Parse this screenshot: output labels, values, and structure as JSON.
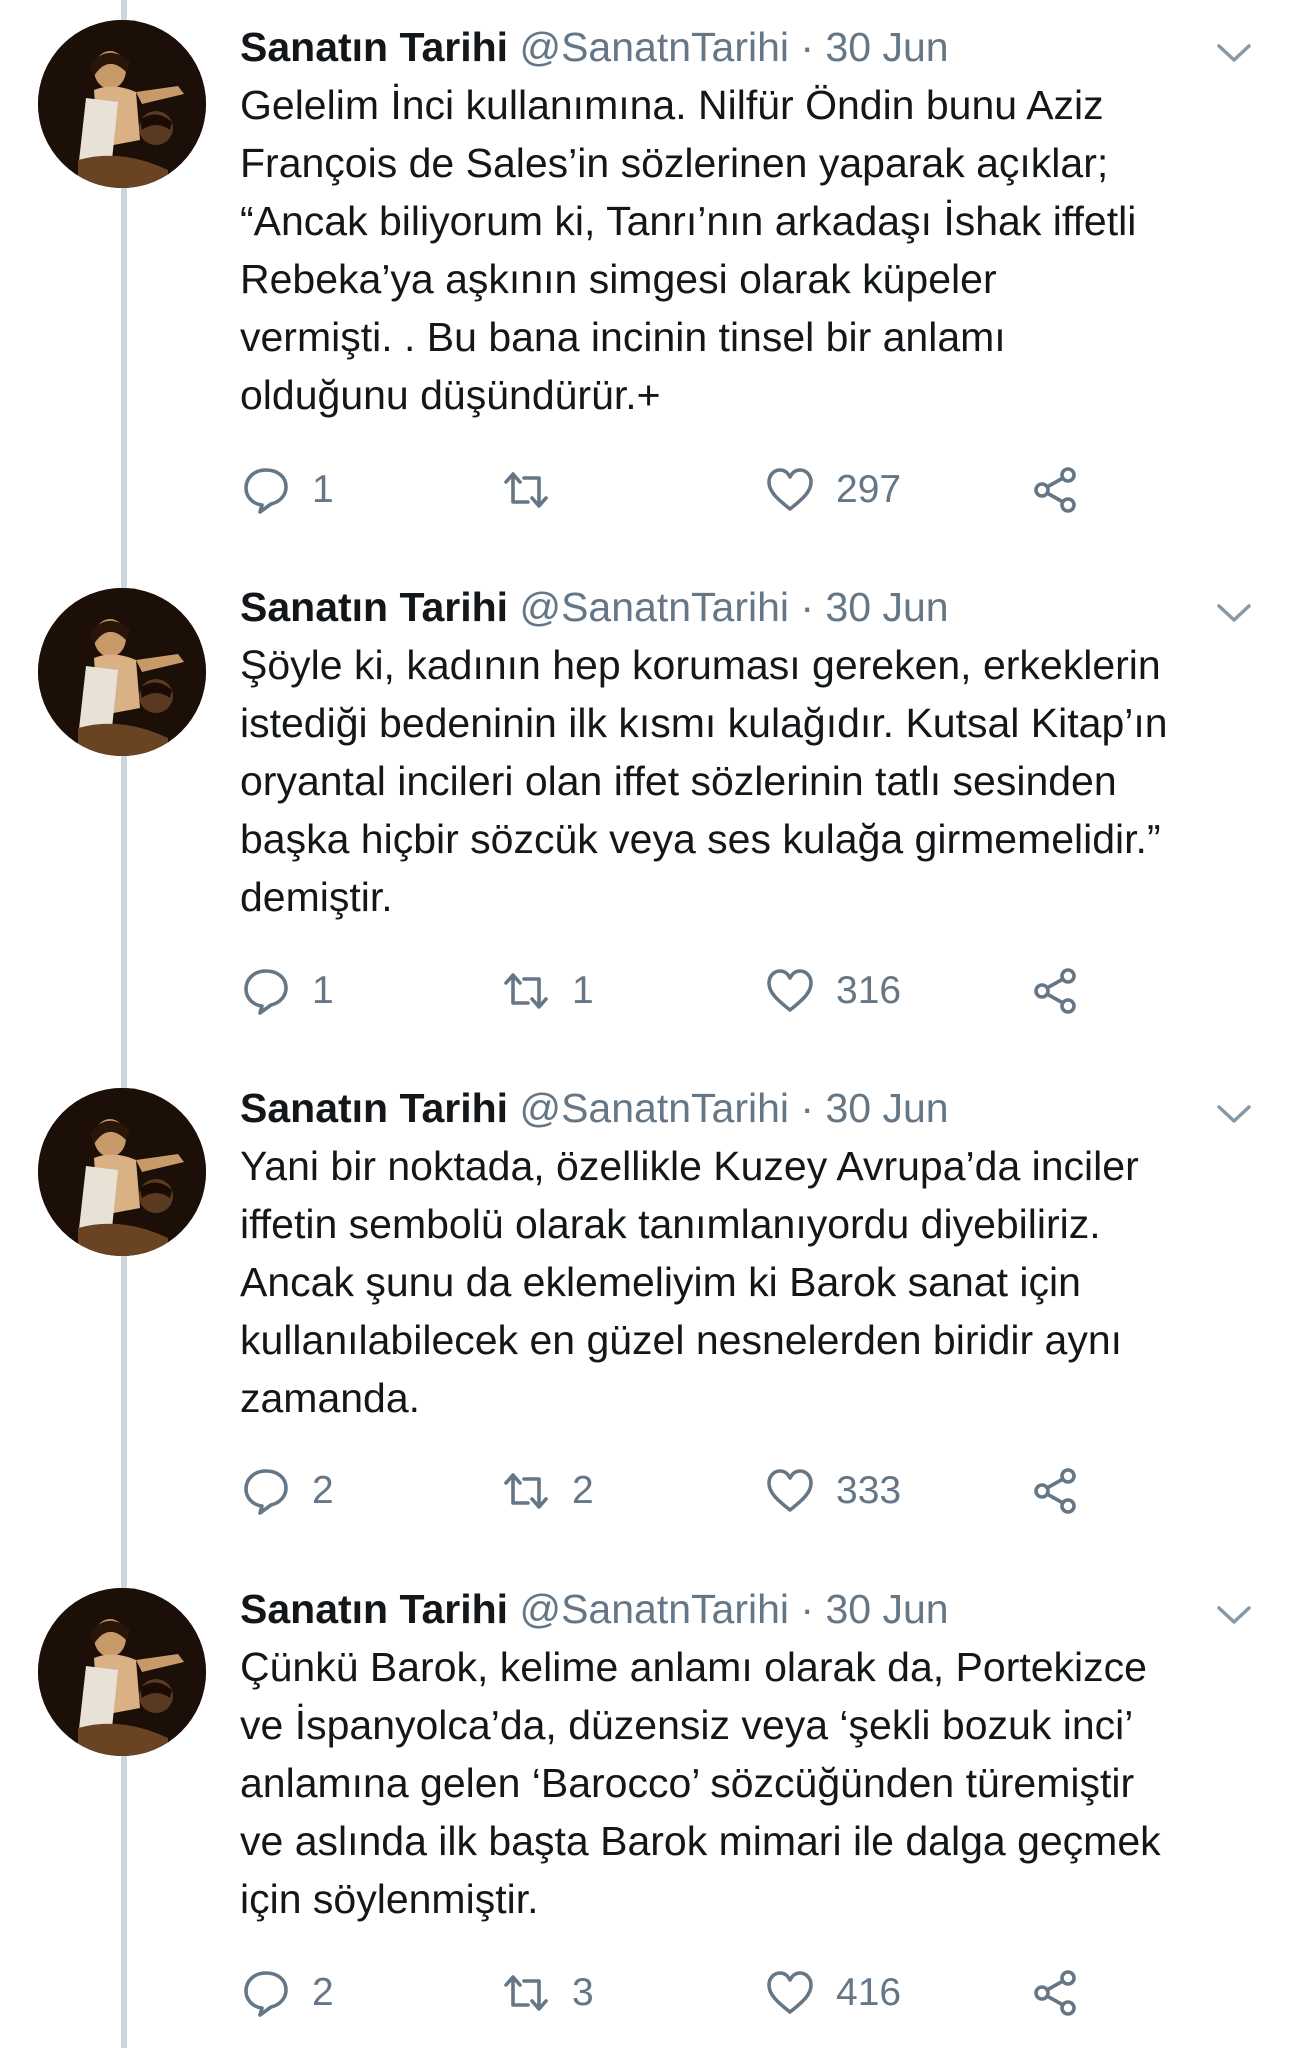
{
  "tweets": [
    {
      "name": "Sanatın Tarihi",
      "handle": "@SanatnTarihi",
      "separator": "·",
      "date": "30 Jun",
      "lines": [
        "Gelelim İnci kullanımına. Nilfür Öndin bunu Aziz",
        "François de Sales’in sözlerinen yaparak açıklar;",
        "“Ancak biliyorum ki, Tanrı’nın arkadaşı İshak iffetli",
        "Rebeka’ya aşkının simgesi olarak küpeler",
        "vermişti. . Bu bana incinin tinsel bir anlamı",
        "olduğunu düşündürür.+"
      ],
      "replies": "1",
      "retweets": "",
      "likes": "297"
    },
    {
      "name": "Sanatın Tarihi",
      "handle": "@SanatnTarihi",
      "separator": "·",
      "date": "30 Jun",
      "lines": [
        "Şöyle ki, kadının hep koruması gereken, erkeklerin",
        "istediği bedeninin ilk kısmı kulağıdır. Kutsal Kitap’ın",
        "oryantal incileri olan iffet sözlerinin tatlı sesinden",
        "başka hiçbir sözcük veya ses kulağa girmemelidir.”",
        "demiştir."
      ],
      "replies": "1",
      "retweets": "1",
      "likes": "316"
    },
    {
      "name": "Sanatın Tarihi",
      "handle": "@SanatnTarihi",
      "separator": "·",
      "date": "30 Jun",
      "lines": [
        "Yani bir noktada, özellikle Kuzey Avrupa’da inciler",
        "iffetin sembolü olarak tanımlanıyordu diyebiliriz.",
        "Ancak şunu da eklemeliyim ki Barok sanat için",
        "kullanılabilecek en güzel nesnelerden biridir aynı",
        "zamanda."
      ],
      "replies": "2",
      "retweets": "2",
      "likes": "333"
    },
    {
      "name": "Sanatın Tarihi",
      "handle": "@SanatnTarihi",
      "separator": "·",
      "date": "30 Jun",
      "lines": [
        "Çünkü Barok, kelime anlamı olarak da, Portekizce",
        "ve İspanyolca’da, düzensiz veya ‘şekli bozuk inci’",
        "anlamına gelen ‘Barocco’ sözcüğünden türemiştir",
        "ve aslında ilk başta Barok mimari ile dalga geçmek",
        "için söylenmiştir."
      ],
      "replies": "2",
      "retweets": "3",
      "likes": "416"
    }
  ],
  "icons": {
    "reply": "reply-icon",
    "retweet": "retweet-icon",
    "like": "heart-icon",
    "share": "share-icon",
    "caret": "chevron-down-icon",
    "avatar": "avatar-painting"
  },
  "colors": {
    "text": "#14171a",
    "secondary": "#657786",
    "thread_line": "#ccd6dd",
    "icon": "#657786"
  }
}
